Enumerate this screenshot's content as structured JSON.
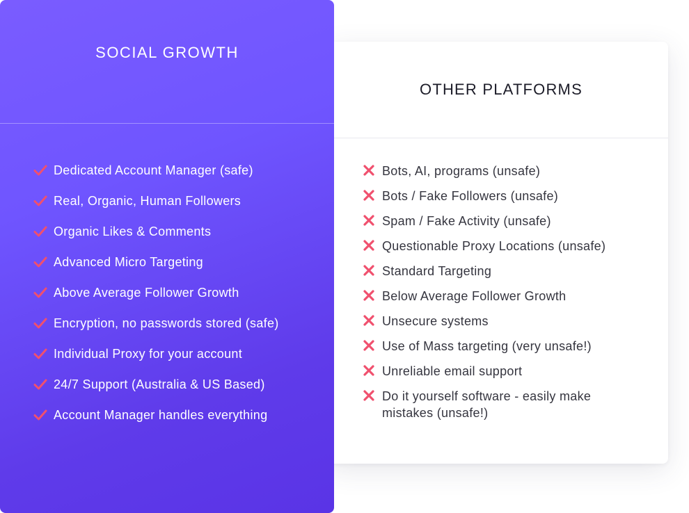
{
  "social_growth": {
    "title": "SOCIAL GROWTH",
    "features": [
      "Dedicated Account Manager (safe)",
      "Real, Organic, Human Followers",
      "Organic Likes & Comments",
      "Advanced Micro Targeting",
      "Above Average Follower Growth",
      "Encryption, no passwords stored (safe)",
      "Individual Proxy for your account",
      "24/7 Support (Australia & US Based)",
      "Account Manager handles everything"
    ],
    "icon": "check-icon",
    "accent_color": "#f0506e"
  },
  "other_platforms": {
    "title": "OTHER PLATFORMS",
    "features": [
      "Bots, AI, programs (unsafe)",
      "Bots / Fake Followers (unsafe)",
      "Spam / Fake Activity (unsafe)",
      "Questionable Proxy Locations (unsafe)",
      "Standard Targeting",
      "Below Average Follower Growth",
      "Unsecure systems",
      "Use of Mass targeting (very unsafe!)",
      "Unreliable email support",
      "Do it yourself software - easily make mistakes (unsafe!)"
    ],
    "icon": "cross-icon",
    "accent_color": "#f0506e"
  }
}
